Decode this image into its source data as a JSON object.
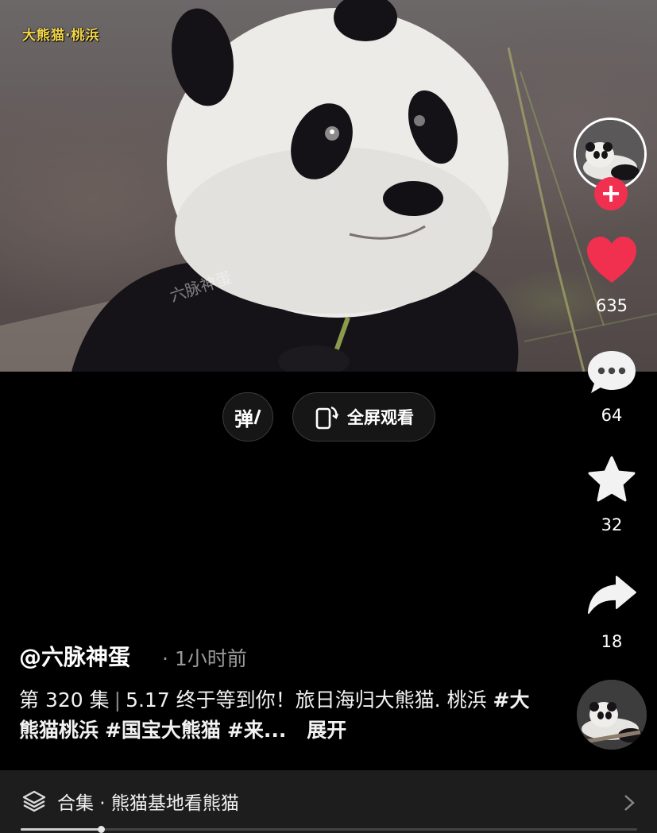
{
  "video": {
    "watermark_top": "大熊猫·桃浜",
    "watermark_mid": "六脉神蛋"
  },
  "controls": {
    "danmu_label": "弹",
    "fullscreen_label": "全屏观看"
  },
  "actions": {
    "likes": "635",
    "comments": "64",
    "favorites": "32",
    "shares": "18",
    "follow_symbol": "+",
    "like_color": "#f1304f"
  },
  "post": {
    "author": "@六脉神蛋",
    "time": "· 1小时前",
    "episode": "第 320 集",
    "separator": "|",
    "caption_text": "5.17 终于等到你！旅日海归大熊猫. 桃浜",
    "tags": [
      "#大熊猫桃浜",
      "#国宝大熊猫",
      "#来..."
    ],
    "expand_label": "展开"
  },
  "collection": {
    "label": "合集 · 熊猫基地看熊猫",
    "progress": 0.13
  },
  "icons": {
    "stack": "stack-icon",
    "chevron": "chevron-right-icon",
    "heart": "heart-icon",
    "comment": "comment-icon",
    "star": "star-icon",
    "share": "share-icon",
    "rotate": "rotate-screen-icon"
  }
}
